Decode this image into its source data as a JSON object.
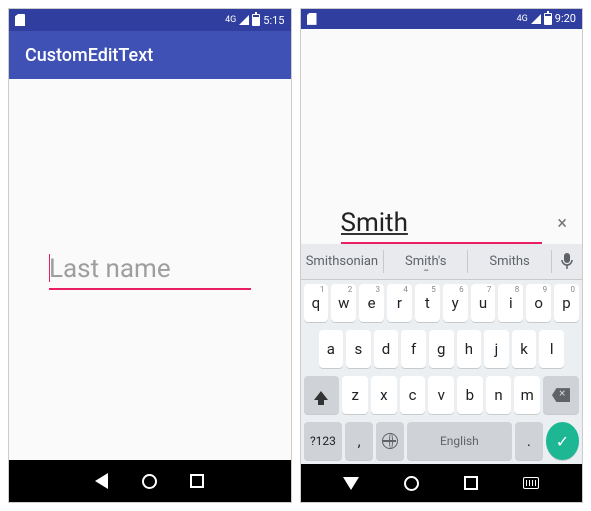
{
  "left": {
    "status": {
      "time": "5:15",
      "signal_label": "4G"
    },
    "app_bar": {
      "title": "CustomEditText"
    },
    "input": {
      "placeholder": "Last name",
      "value": ""
    }
  },
  "right": {
    "status": {
      "time": "9:20",
      "signal_label": "4G"
    },
    "input": {
      "placeholder": "Last name",
      "value": "Smith"
    },
    "suggestions": [
      "Smithsonian",
      "Smith's",
      "Smiths"
    ],
    "keyboard": {
      "row1": [
        {
          "k": "q",
          "s": "1"
        },
        {
          "k": "w",
          "s": "2"
        },
        {
          "k": "e",
          "s": "3"
        },
        {
          "k": "r",
          "s": "4"
        },
        {
          "k": "t",
          "s": "5"
        },
        {
          "k": "y",
          "s": "6"
        },
        {
          "k": "u",
          "s": "7"
        },
        {
          "k": "i",
          "s": "8"
        },
        {
          "k": "o",
          "s": "9"
        },
        {
          "k": "p",
          "s": "0"
        }
      ],
      "row2": [
        "a",
        "s",
        "d",
        "f",
        "g",
        "h",
        "j",
        "k",
        "l"
      ],
      "row3": [
        "z",
        "x",
        "c",
        "v",
        "b",
        "n",
        "m"
      ],
      "symbols_key": "?123",
      "space_label": "English",
      "comma": ",",
      "period": "."
    }
  },
  "colors": {
    "accent": "#E91E63",
    "primary": "#3F51B5",
    "primary_dark": "#303F9F"
  }
}
